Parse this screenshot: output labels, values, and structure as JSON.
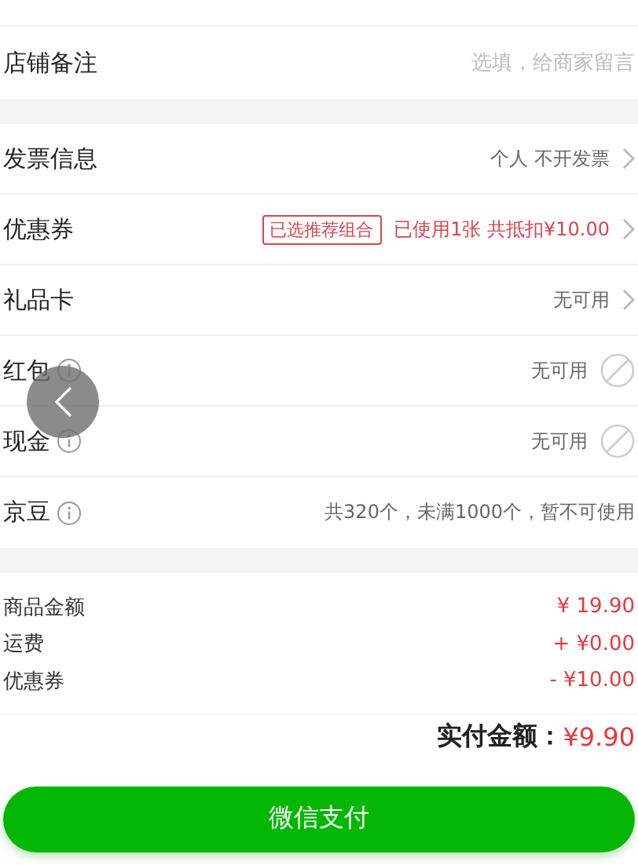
{
  "store_note": {
    "label": "店铺备注",
    "placeholder": "选填，给商家留言"
  },
  "options": [
    {
      "label": "发票信息",
      "info": false,
      "value": "个人 不开发票",
      "highlighted": false,
      "kind": "link"
    },
    {
      "label": "优惠券",
      "info": false,
      "tag": "已选推荐组合",
      "value": "已使用1张 共抵扣¥10.00",
      "highlighted": true,
      "kind": "link"
    },
    {
      "label": "礼品卡",
      "info": false,
      "value": "无可用",
      "highlighted": false,
      "kind": "link"
    },
    {
      "label": "红包",
      "info": true,
      "value": "无可用",
      "highlighted": false,
      "kind": "unavailable"
    },
    {
      "label": "现金",
      "info": true,
      "value": "无可用",
      "highlighted": false,
      "kind": "unavailable"
    },
    {
      "label": "京豆",
      "info": true,
      "value": "共320个，未满1000个，暂不可使用",
      "highlighted": false,
      "kind": "plain"
    }
  ],
  "summary": [
    {
      "label": "商品金额",
      "value": "¥ 19.90"
    },
    {
      "label": "运费",
      "value": "+ ¥0.00"
    },
    {
      "label": "优惠券",
      "value": "- ¥10.00"
    }
  ],
  "total": {
    "label": "实付金额：",
    "value": "¥9.90"
  },
  "pay_button": "微信支付"
}
